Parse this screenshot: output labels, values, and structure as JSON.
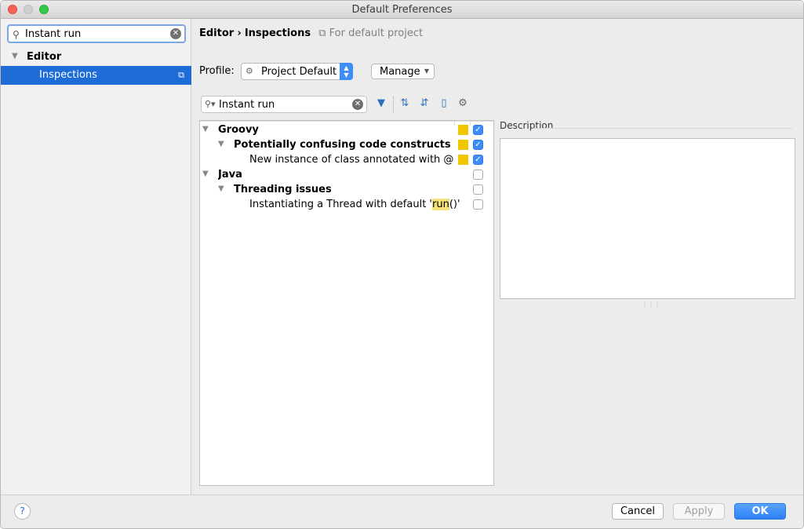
{
  "window": {
    "title": "Default Preferences"
  },
  "left": {
    "search_value": "Instant run",
    "tree": {
      "editor_label": "Editor",
      "inspections_label": "Inspections"
    }
  },
  "breadcrumb": {
    "part1": "Editor",
    "separator": "›",
    "part2": "Inspections",
    "scope": "For default project"
  },
  "profile": {
    "label": "Profile:",
    "value": "Project Default",
    "manage_label": "Manage"
  },
  "filter": {
    "value": "Instant run"
  },
  "toolbar": {
    "icons": [
      "filter-icon",
      "expand-all-icon",
      "collapse-all-icon",
      "reset-icon",
      "settings-icon"
    ]
  },
  "inspections": [
    {
      "label": "Groovy",
      "level": 0,
      "expanded": true,
      "severity": true,
      "checked": true
    },
    {
      "label": "Potentially confusing code constructs",
      "level": 1,
      "expanded": true,
      "severity": true,
      "checked": true
    },
    {
      "label": "New instance of class annotated with @groovy.lang.Singleton",
      "level": 2,
      "severity": true,
      "checked": true
    },
    {
      "label": "Java",
      "level": 0,
      "expanded": true,
      "severity": false,
      "checked": false
    },
    {
      "label": "Threading issues",
      "level": 1,
      "expanded": true,
      "severity": false,
      "checked": false
    },
    {
      "label_prefix": "Instantiating a Thread with default '",
      "label_highlight": "run",
      "label_suffix": "()'",
      "level": 2,
      "severity": false,
      "checked": false
    }
  ],
  "description": {
    "label": "Description"
  },
  "buttons": {
    "help": "?",
    "cancel": "Cancel",
    "apply": "Apply",
    "ok": "OK"
  },
  "colors": {
    "selection": "#1e6cd7",
    "severity_warning": "#f0c600",
    "checkbox_on": "#3d8ef7",
    "search_highlight": "#f6e27a"
  }
}
